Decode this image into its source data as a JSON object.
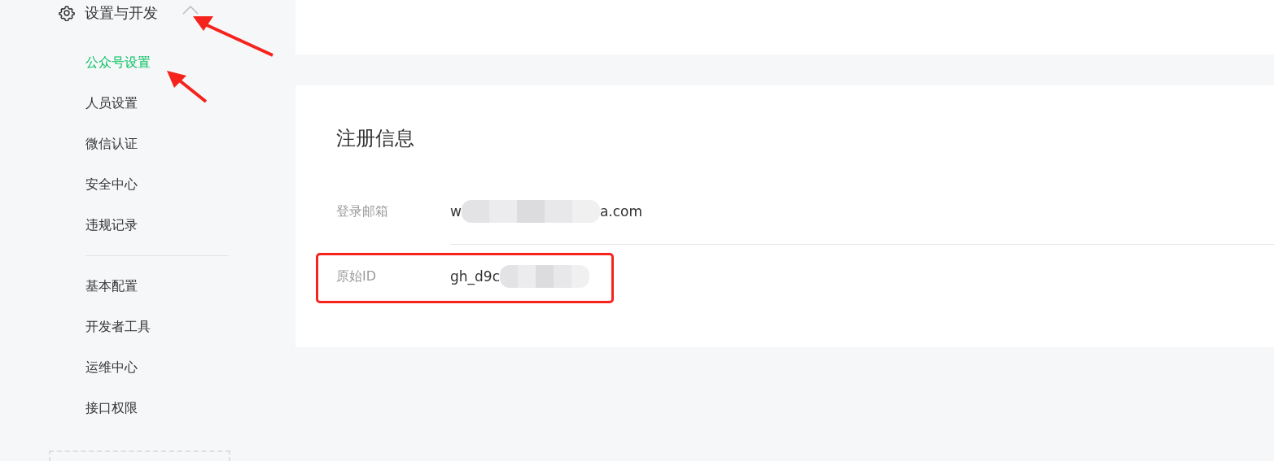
{
  "sidebar": {
    "group": {
      "label": "设置与开发",
      "expanded": true
    },
    "items": [
      {
        "label": "公众号设置",
        "selected": true
      },
      {
        "label": "人员设置",
        "selected": false
      },
      {
        "label": "微信认证",
        "selected": false
      },
      {
        "label": "安全中心",
        "selected": false
      },
      {
        "label": "违规记录",
        "selected": false
      }
    ],
    "items_2": [
      {
        "label": "基本配置",
        "selected": false
      },
      {
        "label": "开发者工具",
        "selected": false
      },
      {
        "label": "运维中心",
        "selected": false
      },
      {
        "label": "接口权限",
        "selected": false
      }
    ]
  },
  "card": {
    "title": "注册信息",
    "rows": [
      {
        "label": "登录邮箱",
        "value_start": "w",
        "value_end": "a.com",
        "highlighted": false
      },
      {
        "label": "原始ID",
        "value_start": "gh_d9c",
        "highlighted": true
      }
    ]
  }
}
